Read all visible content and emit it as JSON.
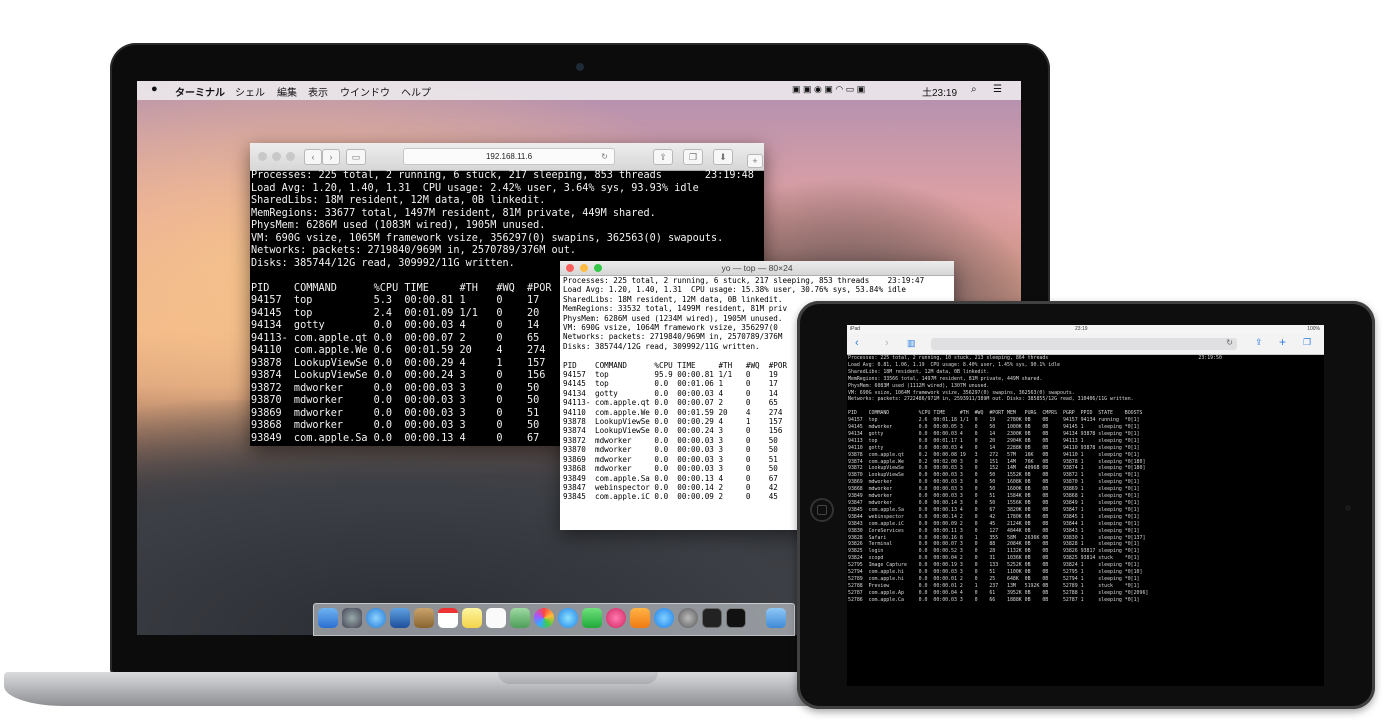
{
  "menubar": {
    "apple": "",
    "app_name": "ターミナル",
    "menus": [
      "シェル",
      "編集",
      "表示",
      "ウインドウ",
      "ヘルプ"
    ],
    "clock": "土23:19"
  },
  "safari": {
    "url": "192.168.11.6",
    "terminal_lines": [
      "Processes: 225 total, 2 running, 6 stuck, 217 sleeping, 853 threads       23:19:48",
      "Load Avg: 1.20, 1.40, 1.31  CPU usage: 2.42% user, 3.64% sys, 93.93% idle",
      "SharedLibs: 18M resident, 12M data, 0B linkedit.",
      "MemRegions: 33677 total, 1497M resident, 81M private, 449M shared.",
      "PhysMem: 6286M used (1083M wired), 1905M unused.",
      "VM: 690G vsize, 1065M framework vsize, 356297(0) swapins, 362563(0) swapouts.",
      "Networks: packets: 2719840/969M in, 2570789/376M out.",
      "Disks: 385744/12G read, 309992/11G written.",
      "",
      "PID    COMMAND      %CPU TIME     #TH   #WQ  #POR",
      "94157  top          5.3  00:00.81 1     0    17",
      "94145  top          2.4  00:01.09 1/1   0    20",
      "94134  gotty        0.0  00:00.03 4     0    14",
      "94113- com.apple.qt 0.0  00:00.07 2     0    65",
      "94110  com.apple.We 0.6  00:01.59 20    4    274",
      "93878  LookupViewSe 0.0  00:00.29 4     1    157",
      "93874  LookupViewSe 0.0  00:00.24 3     0    156",
      "93872  mdworker     0.0  00:00.03 3     0    50",
      "93870  mdworker     0.0  00:00.03 3     0    50",
      "93869  mdworker     0.0  00:00.03 3     0    51",
      "93868  mdworker     0.0  00:00.03 3     0    50",
      "93849  com.apple.Sa 0.0  00:00.13 4     0    67"
    ]
  },
  "terminal": {
    "title": "yo — top — 80×24",
    "lines": [
      "Processes: 225 total, 2 running, 6 stuck, 217 sleeping, 853 threads    23:19:47",
      "Load Avg: 1.20, 1.40, 1.31  CPU usage: 15.38% user, 30.76% sys, 53.84% idle",
      "SharedLibs: 18M resident, 12M data, 0B linkedit.",
      "MemRegions: 33532 total, 1499M resident, 81M priv",
      "PhysMem: 6286M used (1234M wired), 1905M unused.",
      "VM: 690G vsize, 1064M framework vsize, 356297(0",
      "Networks: packets: 2719840/969M in, 2570789/376M",
      "Disks: 385744/12G read, 309992/11G written.",
      "",
      "PID    COMMAND      %CPU TIME     #TH   #WQ  #POR",
      "94157  top          95.9 00:00.81 1/1   0    19",
      "94145  top          0.0  00:01.06 1     0    17",
      "94134  gotty        0.0  00:00.03 4     0    14",
      "94113- com.apple.qt 0.0  00:00.07 2     0    65",
      "94110  com.apple.We 0.0  00:01.59 20    4    274",
      "93878  LookupViewSe 0.0  00:00.29 4     1    157",
      "93874  LookupViewSe 0.0  00:00.24 3     0    156",
      "93872  mdworker     0.0  00:00.03 3     0    50",
      "93870  mdworker     0.0  00:00.03 3     0    50",
      "93869  mdworker     0.0  00:00.03 3     0    51",
      "93868  mdworker     0.0  00:00.03 3     0    50",
      "93849  com.apple.Sa 0.0  00:00.13 4     0    67",
      "93847  webinspector 0.0  00:00.14 2     0    42",
      "93845  com.apple.iC 0.0  00:00.09 2     0    45"
    ]
  },
  "ipad": {
    "status_left": "iPad",
    "status_time": "23:19",
    "status_right": "100%",
    "terminal_lines": [
      "Processes: 225 total, 2 running, 10 stuck, 213 sleeping, 864 threads                                                   23:19:50",
      "Load Avg: 0.81, 1.06, 1.19  CPU usage: 8.40% user, 1.45% sys, 90.1% idle",
      "SharedLibs: 18M resident, 12M data, 0B linkedit.",
      "MemRegions: 33566 total, 1497M resident, 81M private, 449M shared.",
      "PhysMem: 6083M used (1112M wired), 1307M unused.",
      "VM: 690G vsize, 1064M framework vsize, 356297(0) swapins, 362563(0) swapouts.",
      "Networks: packets: 2722486/971M in, 2593911/389M out. Disks: 385855/12G read, 310406/11G written.",
      "",
      "PID    COMMAND          %CPU TIME     #TH  #WQ  #PORT MEM   PURG  CMPRS  PGRP  PPID  STATE    BOOSTS",
      "94157  top              2.6  00:01.18 1/1  0    19    2780K 0B    0B     94157 94134 running  *0[1]",
      "94145  mdworker         0.0  00:00.05 3    0    50    1000K 0B    0B     94145 1     sleeping *0[1]",
      "94134  gotty            0.0  00:00.03 4    0    14    2300K 0B    0B     94134 93878 sleeping *0[1]",
      "94113  top              0.0  00:01.17 1    0    20    2904K 0B    0B     94113 1     sleeping *0[1]",
      "94110  gotty            0.0  00:00.03 4    0    14    2288K 0B    0B     94110 93878 sleeping *0[1]",
      "93878  com.apple.qt     0.2  00:00.08 19   3    272   57M   16K   0B     94110 1     sleeping *0[1]",
      "93874  com.apple.We     0.2  00:02.00 3    0    151   14M   76K   0B     93878 1     sleeping *0[180]",
      "93872  LookupViewSe     0.0  00:00.03 3    0    152   14M   4096B 0B     93874 1     sleeping *0[180]",
      "93870  LookupViewSe     0.0  00:00.03 3    0    50    1552K 0B    0B     93872 1     sleeping *0[1]",
      "93869  mdworker         0.0  00:00.03 3    0    50    1608K 0B    0B     93870 1     sleeping *0[1]",
      "93868  mdworker         0.0  00:00.03 3    0    50    1600K 0B    0B     93869 1     sleeping *0[1]",
      "93849  mdworker         0.0  00:00.03 3    0    51    1584K 0B    0B     93868 1     sleeping *0[1]",
      "93847  mdworker         0.0  00:00.14 3    0    50    1556K 0B    0B     93849 1     sleeping *0[1]",
      "93845  com.apple.Sa     0.0  00:00.13 4    0    67    3820K 0B    0B     93847 1     sleeping *0[1]",
      "93844  webinspector     0.0  00:00.14 2    0    42    1780K 0B    0B     93845 1     sleeping *0[1]",
      "93843  com.apple.iC     0.0  00:00.09 2    0    45    2124K 0B    0B     93844 1     sleeping *0[1]",
      "93830  CoreServices     0.0  00:00.11 3    0    127   4844K 0B    0B     93843 1     sleeping *0[1]",
      "93828  Safari           0.0  00:00.16 8    1    355   58M   2636K 0B     93830 1     sleeping *0[137]",
      "93826  Terminal         0.0  00:00.07 3    0    88    2084K 0B    0B     93828 1     sleeping *0[1]",
      "93825  login            0.0  00:00.52 3    0    28    1132K 0B    0B     93826 93817 sleeping *0[1]",
      "93824  scopd            0.0  00:00.04 2    0    31    1036K 0B    0B     93825 93814 stuck    *0[1]",
      "52795  Image Capture    0.0  00:00.19 3    0    133   5252K 0B    0B     93824 1     sleeping *0[1]",
      "52794  com.apple.hi     0.0  00:00.03 3    0    51    1100K 0B    0B     52795 1     sleeping *0[10]",
      "52789  com.apple.hi     0.0  00:00.01 2    0    25    648K  0B    0B     52794 1     sleeping *0[1]",
      "52788  Preview          0.0  00:00.01 2    1    237   13M   5192K 0B     52789 1     stuck    *0[1]",
      "52787  com.apple.Ap     0.0  00:00.04 4    0    61    3952K 0B    0B     52788 1     sleeping *0[2096]",
      "52786  com.apple.Ca     0.0  00:00.03 3    0    66    1888K 0B    0B     52787 1     sleeping *0[1]"
    ]
  }
}
